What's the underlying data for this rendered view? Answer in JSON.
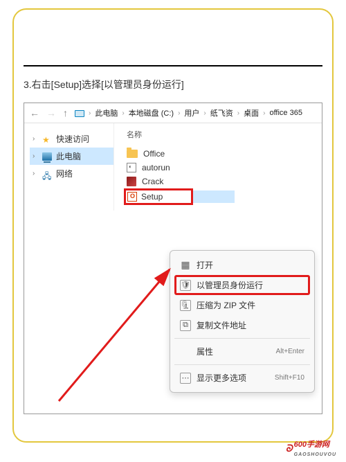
{
  "instruction": "3.右击[Setup]选择[以管理员身份运行]",
  "breadcrumb": [
    "此电脑",
    "本地磁盘 (C:)",
    "用户",
    "纸飞资",
    "桌面",
    "office 365"
  ],
  "column_header": "名称",
  "sidebar": {
    "items": [
      {
        "label": "快速访问"
      },
      {
        "label": "此电脑"
      },
      {
        "label": "网络"
      }
    ]
  },
  "files": [
    {
      "label": "Office"
    },
    {
      "label": "autorun"
    },
    {
      "label": "Crack"
    },
    {
      "label": "Setup"
    }
  ],
  "menu": {
    "open": "打开",
    "run_admin": "以管理员身份运行",
    "zip": "压缩为 ZIP 文件",
    "copy_path": "复制文件地址",
    "props": "属性",
    "props_sc": "Alt+Enter",
    "more": "显示更多选项",
    "more_sc": "Shift+F10"
  },
  "watermark": {
    "text": "600手游网",
    "sub": "GAOSHOUVOU"
  }
}
